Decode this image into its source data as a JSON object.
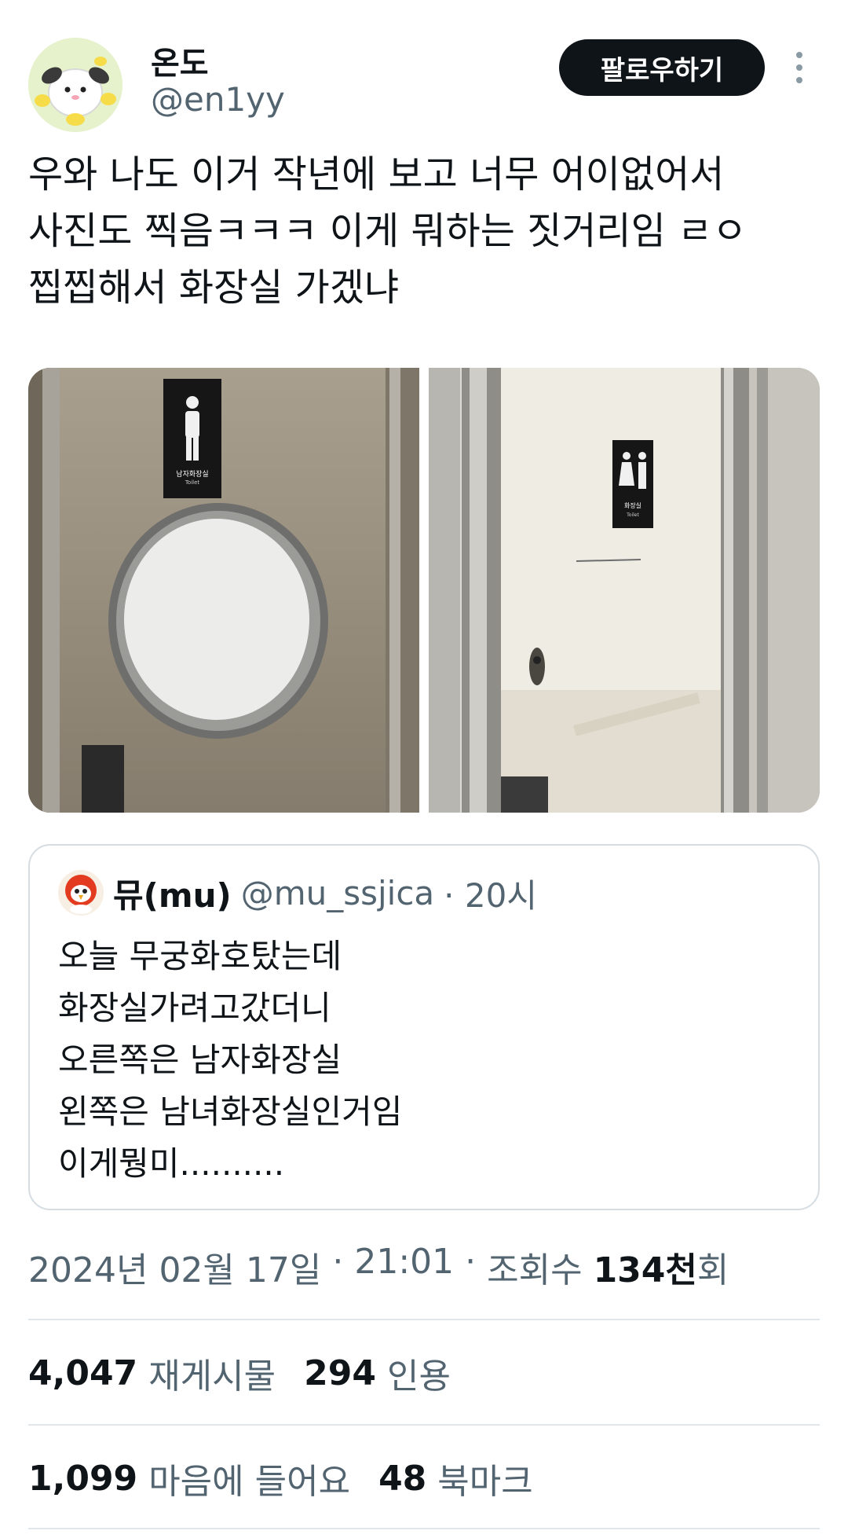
{
  "author": {
    "name": "온도",
    "handle": "@en1yy",
    "follow_label": "팔로우하기"
  },
  "tweet": {
    "lines": [
      "우와 나도 이거 작년에 보고 너무 어이없어서",
      "사진도 찍음ㅋㅋㅋ 이게 뭐하는 짓거리임 ㄹㅇ",
      "찝찝해서 화장실 가겠냐"
    ]
  },
  "photos": {
    "left_sign_text": "남자화장실",
    "left_sign_sub": "Toilet",
    "right_sign_text": "화장실",
    "right_sign_sub": "Toilet"
  },
  "quote": {
    "name": "뮤(mu)",
    "handle": "@mu_ssjica",
    "time": "· 20시",
    "lines": [
      "오늘 무궁화호탔는데",
      "화장실가려고갔더니",
      "오른쪽은 남자화장실",
      "왼쪽은 남녀화장실인거임",
      "이게뭥미.........."
    ]
  },
  "meta": {
    "date": "2024년 02월 17일",
    "sep1": " · ",
    "time": "21:01",
    "sep2": " · ",
    "views_label": "조회수 ",
    "views_count": "134천",
    "views_suffix": "회"
  },
  "stats": {
    "retweets": "4,047",
    "retweets_label": "재게시물",
    "quotes": "294",
    "quotes_label": "인용",
    "likes": "1,099",
    "likes_label": "마음에 들어요",
    "bookmarks": "48",
    "bookmarks_label": "북마크"
  },
  "colors": {
    "text_primary": "#0f1419",
    "text_secondary": "#536471",
    "border": "#d6dde2",
    "follow_bg": "#0f1419"
  }
}
